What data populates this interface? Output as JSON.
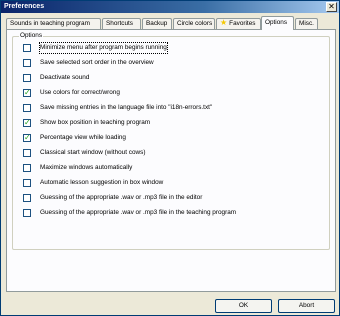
{
  "window": {
    "title": "Preferences",
    "close_glyph": "✕"
  },
  "tabs": [
    {
      "label": "Sounds in teaching program"
    },
    {
      "label": "Shortcuts"
    },
    {
      "label": "Backup"
    },
    {
      "label": "Circle colors"
    },
    {
      "label": "Favorites",
      "icon": "star-icon"
    },
    {
      "label": "Options",
      "active": true
    },
    {
      "label": "Misc."
    }
  ],
  "options_group": {
    "label": "Options",
    "items": [
      {
        "label": "Minimize menu after program begins running",
        "checked": false
      },
      {
        "label": "Save selected sort order in the overview",
        "checked": false
      },
      {
        "label": "Deactivate sound",
        "checked": false
      },
      {
        "label": "Use colors for correct/wrong",
        "checked": true
      },
      {
        "label": "Save missing entries in the language file into \"i18n-errors.txt\"",
        "checked": false
      },
      {
        "label": "Show box position in teaching program",
        "checked": true
      },
      {
        "label": "Percentage view while loading",
        "checked": true
      },
      {
        "label": "Classical start window (without cows)",
        "checked": false
      },
      {
        "label": "Maximize windows automatically",
        "checked": false
      },
      {
        "label": "Automatic lesson suggestion in box window",
        "checked": false
      },
      {
        "label": "Guessing of the appropriate .wav or .mp3 file in the editor",
        "checked": false
      },
      {
        "label": "Guessing of the appropriate .wav or .mp3 file in the teaching program",
        "checked": false
      }
    ]
  },
  "buttons": {
    "ok": "OK",
    "abort": "Abort"
  }
}
